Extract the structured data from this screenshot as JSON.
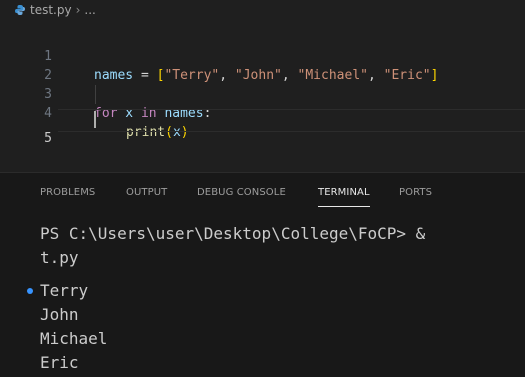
{
  "editor": {
    "breadcrumb": {
      "file": "test.py",
      "symbol": "..."
    },
    "lines": [
      {
        "number": "1",
        "tokens": {
          "var": "names",
          "op": " = ",
          "open": "[",
          "s1": "\"Terry\"",
          "c1": ", ",
          "s2": "\"John\"",
          "c2": ", ",
          "s3": "\"Michael\"",
          "c3": ", ",
          "s4": "\"Eric\"",
          "close": "]"
        }
      },
      {
        "number": "2"
      },
      {
        "number": "3",
        "tokens": {
          "kw1": "for",
          "v1": " x ",
          "kw2": "in",
          "v2": " names",
          "colon": ":"
        }
      },
      {
        "number": "4",
        "tokens": {
          "fn": "print",
          "open": "(",
          "arg": "x",
          "close": ")"
        }
      },
      {
        "number": "5"
      }
    ]
  },
  "panel": {
    "tabs": [
      "PROBLEMS",
      "OUTPUT",
      "DEBUG CONSOLE",
      "TERMINAL",
      "PORTS"
    ],
    "active_tab": "TERMINAL",
    "terminal_lines": [
      "PS C:\\Users\\user\\Desktop\\College\\FoCP> &",
      "t.py",
      "Terry",
      "John",
      "Michael",
      "Eric"
    ]
  },
  "colors": {
    "background": "#1f1f1f",
    "keyword": "#c586c0",
    "variable": "#9cdcfe",
    "function": "#dcdcaa",
    "string": "#ce9178",
    "bracket_level1": "#ffd700",
    "bracket_level2": "#da70d6",
    "terminal_dot": "#3794ff"
  },
  "icons": {
    "breadcrumb_file": "python-file-icon",
    "terminal_decoration": "command-decoration-dot"
  }
}
